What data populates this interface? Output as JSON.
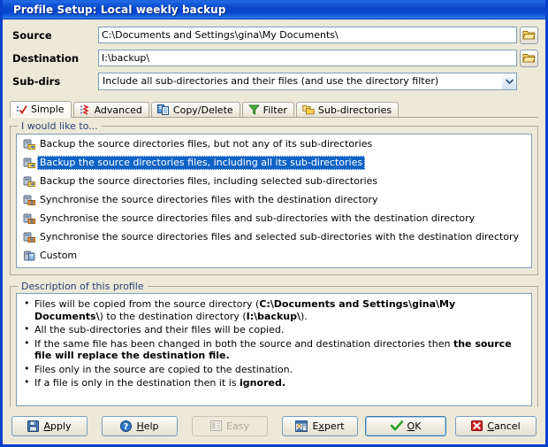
{
  "window": {
    "title": "Profile Setup: Local weekly backup",
    "accent_titlebar": "#0b45cc",
    "face_color": "#ece9d8"
  },
  "fields": [
    {
      "label": "Source",
      "value": "C:\\Documents and Settings\\gina\\My Documents\\",
      "placeholder": "",
      "browse_icon": "folder-icon",
      "type": "text"
    },
    {
      "label": "Destination",
      "value": "I:\\backup\\",
      "placeholder": "",
      "browse_icon": "folder-icon",
      "type": "text"
    },
    {
      "label": "Sub-dirs",
      "value": "Include all sub-directories and their files (and use the directory filter)",
      "placeholder": "",
      "browse_icon": "chevron-down-icon",
      "type": "select"
    }
  ],
  "tabs": [
    {
      "label": "Simple",
      "icon": "red-check-icon",
      "active": true
    },
    {
      "label": "Advanced",
      "icon": "red-zigzag-list-icon",
      "active": false
    },
    {
      "label": "Copy/Delete",
      "icon": "blue-document-pages-icon",
      "active": false
    },
    {
      "label": "Filter",
      "icon": "green-funnel-icon",
      "active": false
    },
    {
      "label": "Sub-directories",
      "icon": "yellow-folders-icon",
      "active": false
    }
  ],
  "options_group": {
    "legend": "I would like to...",
    "items": [
      {
        "label": "Backup the source directories files, but not any of its sub-directories",
        "icon": "backup-folder-icon",
        "selected": false
      },
      {
        "label": "Backup the source directories files, including all its sub-directories",
        "icon": "backup-folder-icon",
        "selected": true
      },
      {
        "label": "Backup the source directories files, including selected sub-directories",
        "icon": "backup-folder-icon",
        "selected": false
      },
      {
        "label": "Synchronise the source directories files with the destination directory",
        "icon": "sync-folder-icon",
        "selected": false
      },
      {
        "label": "Synchronise the source directories files and sub-directories with the destination directory",
        "icon": "sync-folder-icon",
        "selected": false
      },
      {
        "label": "Synchronise the source directories files and selected sub-directories with the destination directory",
        "icon": "sync-folder-icon",
        "selected": false
      },
      {
        "label": "Custom",
        "icon": "custom-folder-icon",
        "selected": false
      }
    ]
  },
  "description_group": {
    "legend": "Description of this profile",
    "bullets": [
      {
        "parts": [
          {
            "text": "Files will be copied from the source directory (",
            "bold": false
          },
          {
            "text": "C:\\Documents and Settings\\gina\\My Documents\\",
            "bold": true
          },
          {
            "text": ") to the destination directory (",
            "bold": false
          },
          {
            "text": "I:\\backup\\",
            "bold": true
          },
          {
            "text": ").",
            "bold": false
          }
        ]
      },
      {
        "parts": [
          {
            "text": "All the sub-directories and their files will be copied.",
            "bold": false
          }
        ]
      },
      {
        "parts": [
          {
            "text": "If the same file has been changed in both the source and destination directories then ",
            "bold": false
          },
          {
            "text": "the source file will replace the destination file.",
            "bold": true
          }
        ]
      },
      {
        "parts": [
          {
            "text": "Files only in the source are copied to the destination.",
            "bold": false
          }
        ]
      },
      {
        "parts": [
          {
            "text": "If a file is only in the destination then it is ",
            "bold": false
          },
          {
            "text": "ignored.",
            "bold": true
          }
        ]
      }
    ]
  },
  "buttons": {
    "apply": {
      "label": "Apply",
      "accel": "A",
      "icon": "floppy-save-icon",
      "enabled": true,
      "default": false
    },
    "help": {
      "label": "Help",
      "accel": "H",
      "icon": "question-help-icon",
      "enabled": true,
      "default": false
    },
    "easy": {
      "label": "Easy",
      "accel": "",
      "icon": "easy-panel-icon",
      "enabled": false,
      "default": false
    },
    "expert": {
      "label": "Expert",
      "accel": "x",
      "icon": "expert-user-icon",
      "enabled": true,
      "default": false
    },
    "ok": {
      "label": "OK",
      "accel": "O",
      "icon": "green-check-icon",
      "enabled": true,
      "default": true
    },
    "cancel": {
      "label": "Cancel",
      "accel": "C",
      "icon": "red-cross-icon",
      "enabled": true,
      "default": false
    }
  }
}
